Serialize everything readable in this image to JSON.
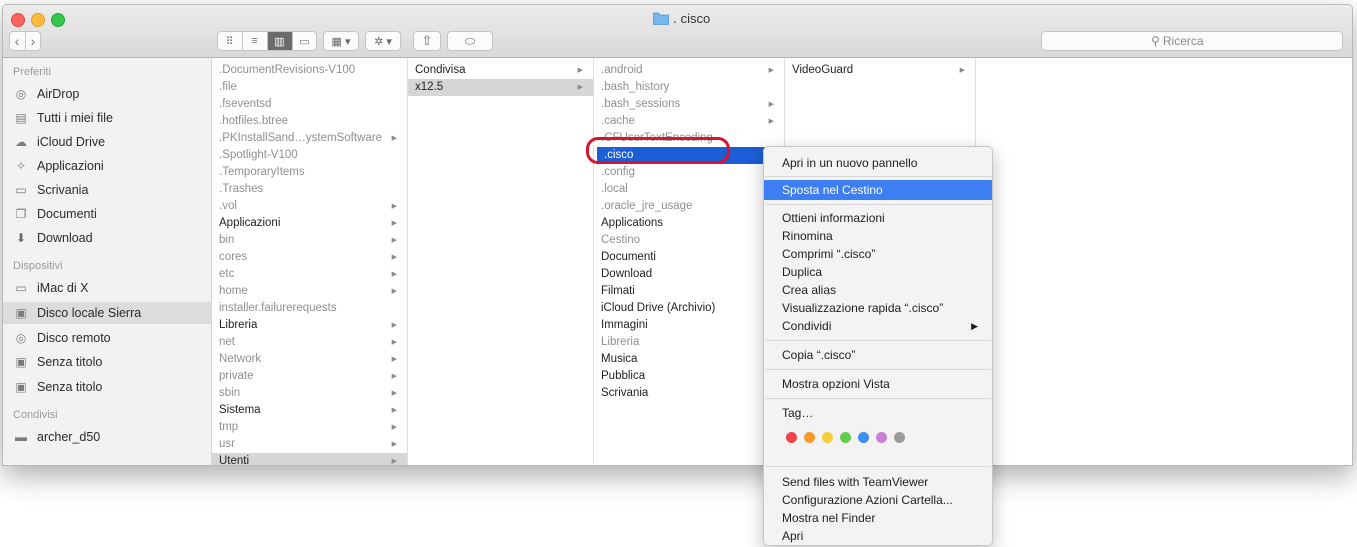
{
  "window": {
    "title": "cisco"
  },
  "toolbar": {
    "back": "‹",
    "forward": "›",
    "view_icons": [
      "⠿",
      "≡",
      "▥",
      "▭"
    ],
    "group": "▦ ▾",
    "action": "✲ ▾",
    "share": "⇧",
    "tag": "⬭",
    "search_placeholder": "Ricerca"
  },
  "sidebar": {
    "sections": [
      {
        "heading": "Preferiti",
        "items": [
          {
            "label": "AirDrop",
            "icon": "airdrop-icon"
          },
          {
            "label": "Tutti i miei file",
            "icon": "all-files-icon"
          },
          {
            "label": "iCloud Drive",
            "icon": "cloud-icon"
          },
          {
            "label": "Applicazioni",
            "icon": "applications-icon"
          },
          {
            "label": "Scrivania",
            "icon": "desktop-icon"
          },
          {
            "label": "Documenti",
            "icon": "documents-icon"
          },
          {
            "label": "Download",
            "icon": "download-icon"
          }
        ]
      },
      {
        "heading": "Dispositivi",
        "items": [
          {
            "label": "iMac di X",
            "icon": "imac-icon"
          },
          {
            "label": "Disco locale Sierra",
            "icon": "disk-icon",
            "selected": true
          },
          {
            "label": "Disco remoto",
            "icon": "remote-disc-icon"
          },
          {
            "label": "Senza titolo",
            "icon": "disk-icon"
          },
          {
            "label": "Senza titolo",
            "icon": "disk-icon"
          }
        ]
      },
      {
        "heading": "Condivisi",
        "items": [
          {
            "label": "archer_d50",
            "icon": "network-computer-icon"
          }
        ]
      }
    ]
  },
  "columns": [
    {
      "items": [
        {
          "label": ".DocumentRevisions-V100",
          "hidden": true
        },
        {
          "label": ".file",
          "hidden": true
        },
        {
          "label": ".fseventsd",
          "hidden": true
        },
        {
          "label": ".hotfiles.btree",
          "hidden": true
        },
        {
          "label": ".PKInstallSand…ystemSoftware",
          "hidden": true,
          "arrow": true
        },
        {
          "label": ".Spotlight-V100",
          "hidden": true
        },
        {
          "label": ".TemporaryItems",
          "hidden": true
        },
        {
          "label": ".Trashes",
          "hidden": true
        },
        {
          "label": ".vol",
          "hidden": true,
          "arrow": true
        },
        {
          "label": "Applicazioni",
          "arrow": true
        },
        {
          "label": "bin",
          "hidden": true,
          "arrow": true
        },
        {
          "label": "cores",
          "hidden": true,
          "arrow": true
        },
        {
          "label": "etc",
          "hidden": true,
          "arrow": true
        },
        {
          "label": "home",
          "hidden": true,
          "arrow": true
        },
        {
          "label": "installer.failurerequests",
          "hidden": true
        },
        {
          "label": "Libreria",
          "arrow": true
        },
        {
          "label": "net",
          "hidden": true,
          "arrow": true
        },
        {
          "label": "Network",
          "hidden": true,
          "arrow": true
        },
        {
          "label": "private",
          "hidden": true,
          "arrow": true
        },
        {
          "label": "sbin",
          "hidden": true,
          "arrow": true
        },
        {
          "label": "Sistema",
          "arrow": true
        },
        {
          "label": "tmp",
          "hidden": true,
          "arrow": true
        },
        {
          "label": "usr",
          "hidden": true,
          "arrow": true
        },
        {
          "label": "Utenti",
          "arrow": true,
          "selected": true
        }
      ]
    },
    {
      "items": [
        {
          "label": "Condivisa",
          "arrow": true
        },
        {
          "label": "x12.5",
          "arrow": true,
          "selected": true
        }
      ]
    },
    {
      "items": [
        {
          "label": ".android",
          "hidden": true,
          "arrow": true
        },
        {
          "label": ".bash_history",
          "hidden": true
        },
        {
          "label": ".bash_sessions",
          "hidden": true,
          "arrow": true
        },
        {
          "label": ".cache",
          "hidden": true,
          "arrow": true
        },
        {
          "label": ".CFUserTextEncoding",
          "hidden": true
        },
        {
          "label": ".cisco",
          "hidden": true,
          "arrow": true,
          "focused": true
        },
        {
          "label": ".config",
          "hidden": true,
          "arrow": true
        },
        {
          "label": ".local",
          "hidden": true,
          "arrow": true
        },
        {
          "label": ".oracle_jre_usage",
          "hidden": true,
          "arrow": true
        },
        {
          "label": "Applications",
          "arrow": true
        },
        {
          "label": "Cestino",
          "hidden": true,
          "arrow": true
        },
        {
          "label": "Documenti",
          "arrow": true
        },
        {
          "label": "Download",
          "arrow": true
        },
        {
          "label": "Filmati",
          "arrow": true
        },
        {
          "label": "iCloud Drive (Archivio)",
          "arrow": true
        },
        {
          "label": "Immagini",
          "arrow": true
        },
        {
          "label": "Libreria",
          "hidden": true,
          "arrow": true
        },
        {
          "label": "Musica",
          "arrow": true
        },
        {
          "label": "Pubblica",
          "arrow": true
        },
        {
          "label": "Scrivania",
          "arrow": true
        }
      ]
    },
    {
      "items": [
        {
          "label": "VideoGuard",
          "arrow": true
        }
      ]
    }
  ],
  "context_menu": {
    "open_new_tab": "Apri in un nuovo pannello",
    "move_to_trash": "Sposta nel Cestino",
    "get_info": "Ottieni informazioni",
    "rename": "Rinomina",
    "compress": "Comprimi “.cisco”",
    "duplicate": "Duplica",
    "make_alias": "Crea alias",
    "quick_look": "Visualizzazione rapida “.cisco”",
    "share": "Condividi",
    "copy": "Copia “.cisco”",
    "show_view_options": "Mostra opzioni Vista",
    "tags": "Tag…",
    "tag_colors": [
      "#f4424c",
      "#f79a2a",
      "#f6cf36",
      "#5fcf4a",
      "#3a8ff0",
      "#c97ed8",
      "#9c9c9c"
    ],
    "teamviewer": "Send files with TeamViewer",
    "folder_actions": "Configurazione Azioni Cartella...",
    "show_in_finder": "Mostra nel Finder",
    "open": "Apri"
  }
}
